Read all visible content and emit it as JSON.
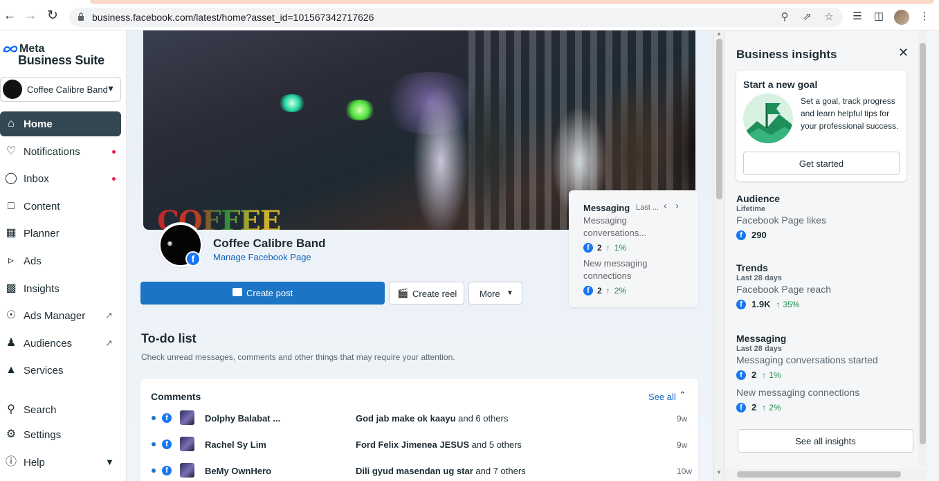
{
  "browser": {
    "url": "business.facebook.com/latest/home?asset_id=101567342717626"
  },
  "sidebar": {
    "logo_top": "Meta",
    "logo_bottom": "Business Suite",
    "account_name": "Coffee Calibre Band",
    "items": [
      {
        "label": "Home",
        "icon": "home-icon"
      },
      {
        "label": "Notifications",
        "icon": "bell-icon"
      },
      {
        "label": "Inbox",
        "icon": "chat-icon"
      },
      {
        "label": "Content",
        "icon": "content-icon"
      },
      {
        "label": "Planner",
        "icon": "calendar-icon"
      },
      {
        "label": "Ads",
        "icon": "megaphone-icon"
      },
      {
        "label": "Insights",
        "icon": "bar-chart-icon"
      },
      {
        "label": "Ads Manager",
        "icon": "ads-manager-icon"
      },
      {
        "label": "Audiences",
        "icon": "people-icon"
      },
      {
        "label": "Services",
        "icon": "bell-service-icon"
      },
      {
        "label": "Search",
        "icon": "search-icon"
      },
      {
        "label": "Settings",
        "icon": "gear-icon"
      },
      {
        "label": "Help",
        "icon": "help-icon"
      }
    ]
  },
  "main": {
    "cover_text": "COFFEE",
    "page_name": "Coffee Calibre Band",
    "manage_link": "Manage Facebook Page",
    "create_post": "Create post",
    "create_reel": "Create reel",
    "more": "More",
    "messaging_card": {
      "title": "Messaging",
      "period": "Last ...",
      "metric1_label": "Messaging conversations...",
      "metric1_value": "2",
      "metric1_change": "1%",
      "metric2_label": "New messaging connections",
      "metric2_value": "2",
      "metric2_change": "2%"
    },
    "todo_title": "To-do list",
    "todo_subtitle": "Check unread messages, comments and other things that may require your attention.",
    "comments": {
      "title": "Comments",
      "see_all": "See all",
      "rows": [
        {
          "name": "Dolphy Balabat ...",
          "bold_text": "God jab make ok kaayu",
          "rest_text": " and 6 others",
          "time": "9w"
        },
        {
          "name": "Rachel Sy Lim",
          "bold_text": "Ford Felix Jimenea JESUS",
          "rest_text": " and 5 others",
          "time": "9w"
        },
        {
          "name": "BeMy OwnHero",
          "bold_text": "Dili gyud masendan ug star",
          "rest_text": " and 7 others",
          "time": "10w"
        }
      ]
    }
  },
  "insights": {
    "title": "Business insights",
    "goal": {
      "title": "Start a new goal",
      "desc": "Set a goal, track progress and learn helpful tips for your professional success.",
      "button": "Get started"
    },
    "audience": {
      "title": "Audience",
      "period": "Lifetime",
      "metric": "Facebook Page likes",
      "value": "290",
      "change": ""
    },
    "trends": {
      "title": "Trends",
      "period": "Last 28 days",
      "metric": "Facebook Page reach",
      "value": "1.9K",
      "change": "35%"
    },
    "messaging": {
      "title": "Messaging",
      "period": "Last 28 days",
      "metric1": "Messaging conversations started",
      "value1": "2",
      "change1": "1%",
      "metric2": "New messaging connections",
      "value2": "2",
      "change2": "2%"
    },
    "see_all": "See all insights"
  }
}
